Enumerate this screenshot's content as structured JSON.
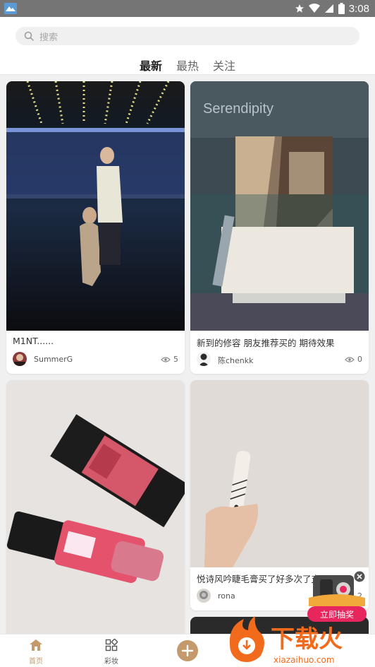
{
  "status": {
    "time": "3:08"
  },
  "search": {
    "placeholder": "搜索"
  },
  "tabs": [
    {
      "label": "最新",
      "active": true
    },
    {
      "label": "最热",
      "active": false
    },
    {
      "label": "关注",
      "active": false
    }
  ],
  "posts": [
    {
      "title": "M1NT......",
      "user": "SummerG",
      "views": "5"
    },
    {
      "title": "新到的修容 朋友推荐买的 期待效果",
      "user": "陈chenkk",
      "views": "0"
    },
    {
      "title": "",
      "user": "",
      "views": ""
    },
    {
      "title": "悦诗风吟睫毛膏买了好多次了支",
      "user": "rona",
      "views": "2"
    }
  ],
  "nav": {
    "home": "首页",
    "makeup": "彩妆"
  },
  "promo": {
    "label": "立即抽奖"
  },
  "watermark": {
    "brand": "下载火",
    "domain": "xiazaihuo.com"
  },
  "colors": {
    "accent": "#c49a6c",
    "nav_active": "#c49a6c",
    "promo": "#e8265e",
    "watermark": "#f26a1b"
  },
  "icons": [
    "search-icon",
    "eye-icon",
    "home-icon",
    "grid-icon",
    "plus-icon",
    "close-icon",
    "wifi-icon",
    "battery-icon",
    "star-icon"
  ]
}
